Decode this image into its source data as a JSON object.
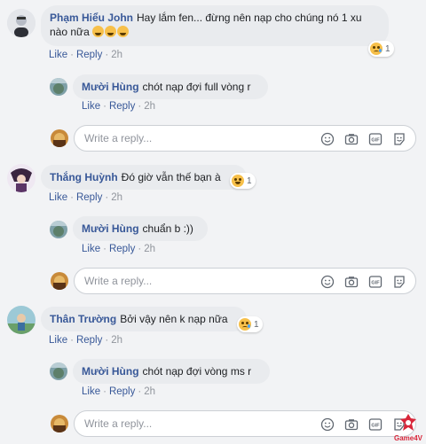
{
  "actions": {
    "like": "Like",
    "reply": "Reply",
    "sep": "·"
  },
  "reply_placeholder": "Write a reply...",
  "comments": [
    {
      "author": "Phạm Hiểu John",
      "text": "Hay lắm fen... đừng nên nạp cho chúng nó 1 xu",
      "text_line2": "nào nữa",
      "time": "2h",
      "reaction": {
        "type": "sad",
        "count": "1"
      },
      "reply": {
        "author": "Mười Hùng",
        "text": "chót nạp đợi full vòng r",
        "time": "2h"
      }
    },
    {
      "author": "Thắng Huỳnh",
      "text": "Đó giờ vẫn thế bạn à",
      "time": "2h",
      "reaction": {
        "type": "haha",
        "count": "1"
      },
      "reply": {
        "author": "Mười Hùng",
        "text": "chuẩn b :))",
        "time": "2h"
      }
    },
    {
      "author": "Thân Trường",
      "text": "Bởi vậy nên k nạp nữa",
      "time": "2h",
      "reaction": {
        "type": "sad",
        "count": "1"
      },
      "reply": {
        "author": "Mười Hùng",
        "text": "chót nạp đợi vòng ms r",
        "time": "2h"
      }
    }
  ],
  "watermark": "Game4V",
  "colors": {
    "link": "#385898",
    "bubble": "#e9ebee",
    "background": "#f2f3f5"
  },
  "icons": [
    "emoji-icon",
    "camera-icon",
    "gif-icon",
    "sticker-icon"
  ]
}
